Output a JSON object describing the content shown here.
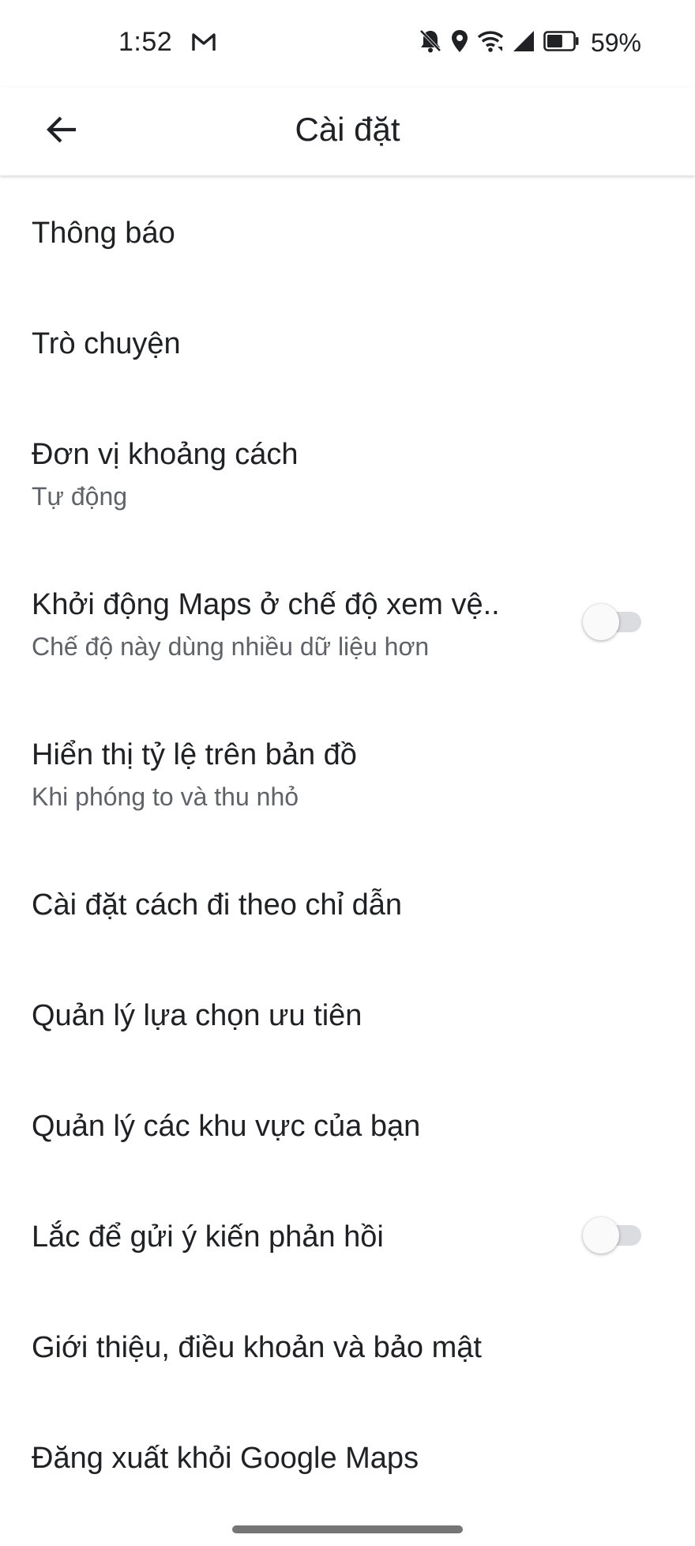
{
  "status_bar": {
    "time": "1:52",
    "battery_percent": "59%",
    "battery_level": 0.59,
    "icons": [
      "gmail-icon",
      "notifications-off-icon",
      "location-icon",
      "wifi-icon",
      "cell-signal-icon",
      "battery-icon"
    ]
  },
  "app_bar": {
    "title": "Cài đặt",
    "back_icon": "arrow-back-icon"
  },
  "settings": {
    "notifications": {
      "title": "Thông báo"
    },
    "chat": {
      "title": "Trò chuyện"
    },
    "distance_units": {
      "title": "Đơn vị khoảng cách",
      "subtitle": "Tự động"
    },
    "satellite_view": {
      "title": "Khởi động Maps ở chế độ xem vệ..",
      "subtitle": "Chế độ này dùng nhiều dữ liệu hơn",
      "enabled": false
    },
    "show_scale": {
      "title": "Hiển thị tỷ lệ trên bản đồ",
      "subtitle": "Khi phóng to và thu nhỏ"
    },
    "navigation_settings": {
      "title": "Cài đặt cách đi theo chỉ dẫn"
    },
    "manage_preferences": {
      "title": "Quản lý lựa chọn ưu tiên"
    },
    "manage_areas": {
      "title": "Quản lý các khu vực của bạn"
    },
    "shake_feedback": {
      "title": "Lắc để gửi ý kiến phản hồi",
      "enabled": false
    },
    "about": {
      "title": "Giới thiệu, điều khoản và bảo mật"
    },
    "sign_out": {
      "title": "Đăng xuất khỏi Google Maps"
    }
  },
  "colors": {
    "text_primary": "#202124",
    "text_secondary": "#5f6368",
    "toggle_track_off": "#dadce0",
    "toggle_thumb_off": "#fafafa"
  }
}
